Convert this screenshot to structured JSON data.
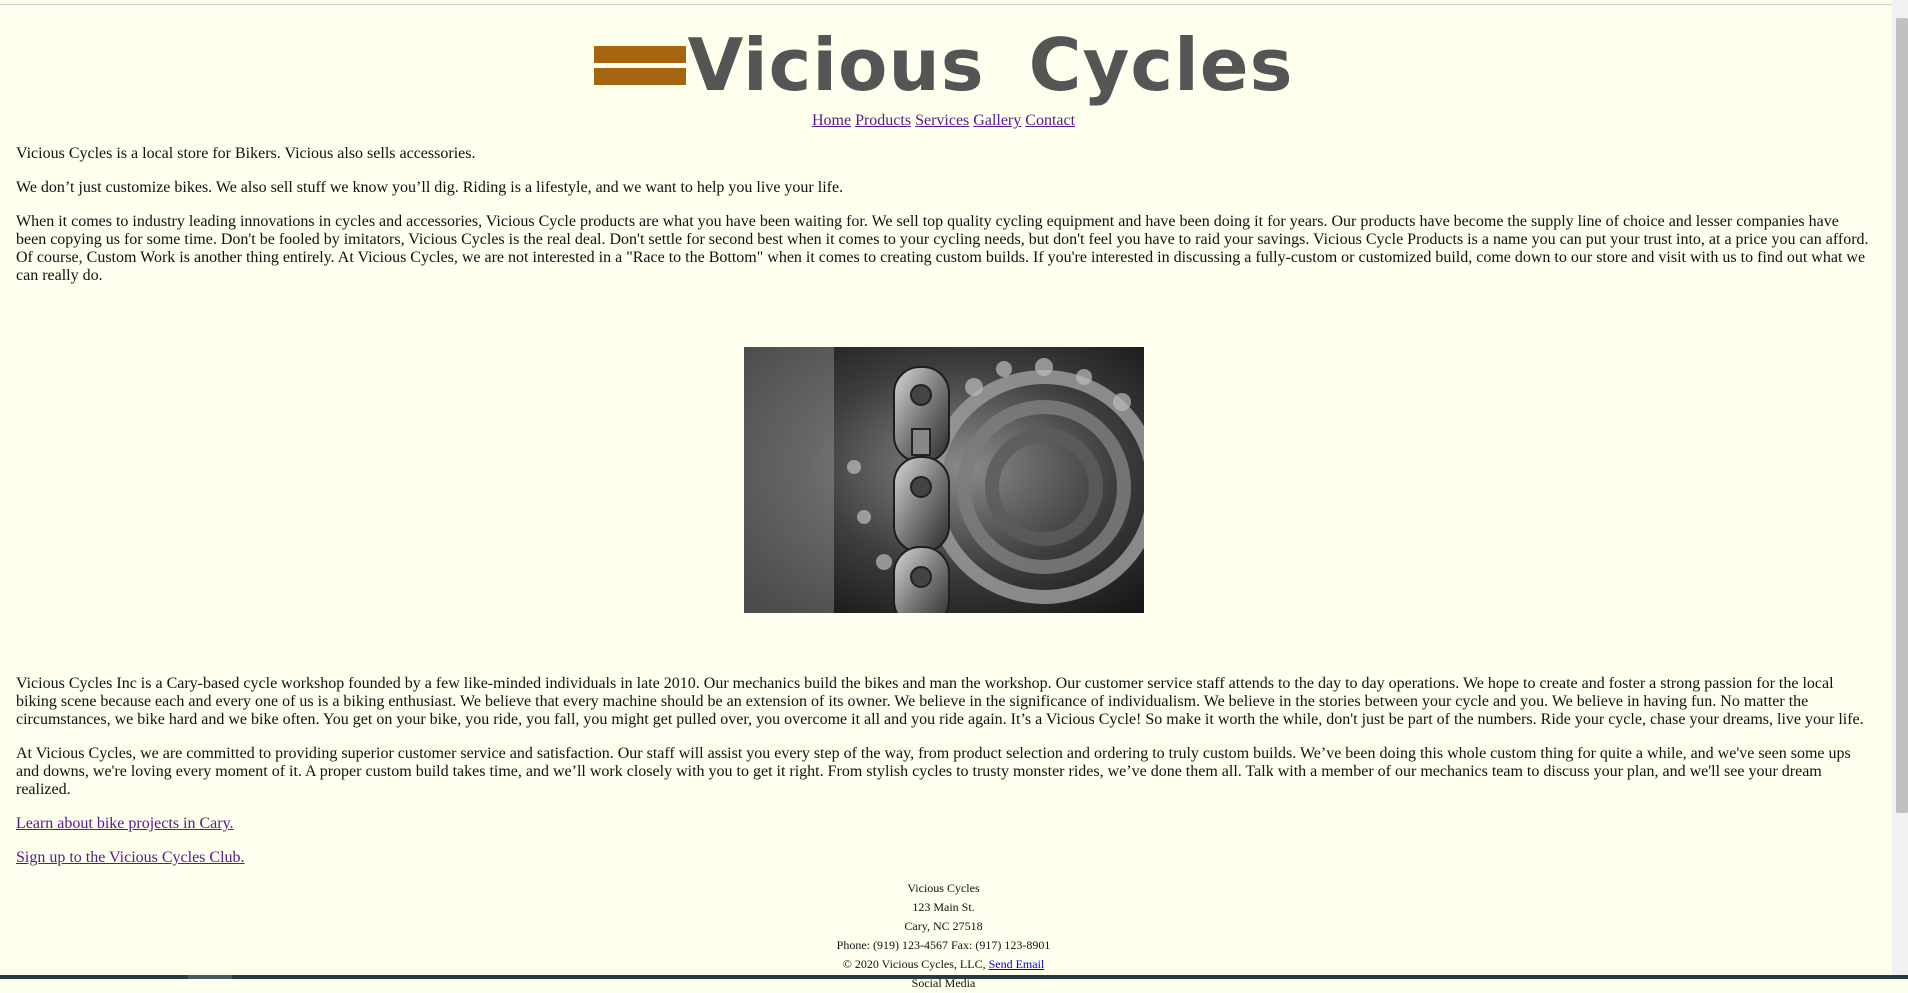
{
  "brand": {
    "name": "Vicious Cycles",
    "logo_bar_color": "#a6650f",
    "logo_text_color": "#555555"
  },
  "nav": {
    "items": [
      "Home",
      "Products",
      "Services",
      "Gallery",
      "Contact"
    ]
  },
  "intro": {
    "p1": "Vicious Cycles is a local store for Bikers. Vicious also sells accessories.",
    "p2": "We don’t just customize bikes. We also sell stuff we know you’ll dig. Riding is a lifestyle, and we want to help you live your life.",
    "p3": "When it comes to industry leading innovations in cycles and accessories, Vicious Cycle products are what you have been waiting for. We sell top quality cycling equipment and have been doing it for years. Our products have become the supply line of choice and lesser companies have been copying us for some time. Don't be fooled by imitators, Vicious Cycles is the real deal. Don't settle for second best when it comes to your cycling needs, but don't feel you have to raid your savings. Vicious Cycle Products is a name you can put your trust into, at a price you can afford. Of course, Custom Work is another thing entirely. At Vicious Cycles, we are not interested in a \"Race to the Bottom\" when it comes to creating custom builds. If you're interested in discussing a fully-custom or customized build, come down to our store and visit with us to find out what we can really do."
  },
  "about": {
    "p4": "Vicious Cycles Inc is a Cary-based cycle workshop founded by a few like-minded individuals in late 2010. Our mechanics build the bikes and man the workshop. Our customer service staff attends to the day to day operations. We hope to create and foster a strong passion for the local biking scene because each and every one of us is a biking enthusiast. We believe that every machine should be an extension of its owner. We believe in the significance of individualism. We believe in the stories between your cycle and you. We believe in having fun. No matter the circumstances, we bike hard and we bike often. You get on your bike, you ride, you fall, you might get pulled over, you overcome it all and you ride again. It’s a Vicious Cycle! So make it worth the while, don't just be part of the numbers. Ride your cycle, chase your dreams, live your life.",
    "p5": "At Vicious Cycles, we are committed to providing superior customer service and satisfaction. Our staff will assist you every step of the way, from product selection and ordering to truly custom builds. We’ve been doing this whole custom thing for quite a while, and we've seen some ups and downs, we're loving every moment of it. A proper custom build takes time, and we’ll work closely with you to get it right. From stylish cycles to trusty monster rides, we’ve done them all. Talk with a member of our mechanics team to discuss your plan, and we'll see your dream realized."
  },
  "links": {
    "projects": "Learn about bike projects in Cary.",
    "club": "Sign up to the Vicious Cycles Club."
  },
  "footer": {
    "name": "Vicious Cycles",
    "street": "123 Main St.",
    "city": "Cary, NC 27518",
    "phones": "Phone: (919) 123-4567 Fax: (917) 123-8901",
    "copyright": "© 2020 Vicious Cycles, LLC,",
    "email_link": "Send Email",
    "social": "Social Media"
  }
}
